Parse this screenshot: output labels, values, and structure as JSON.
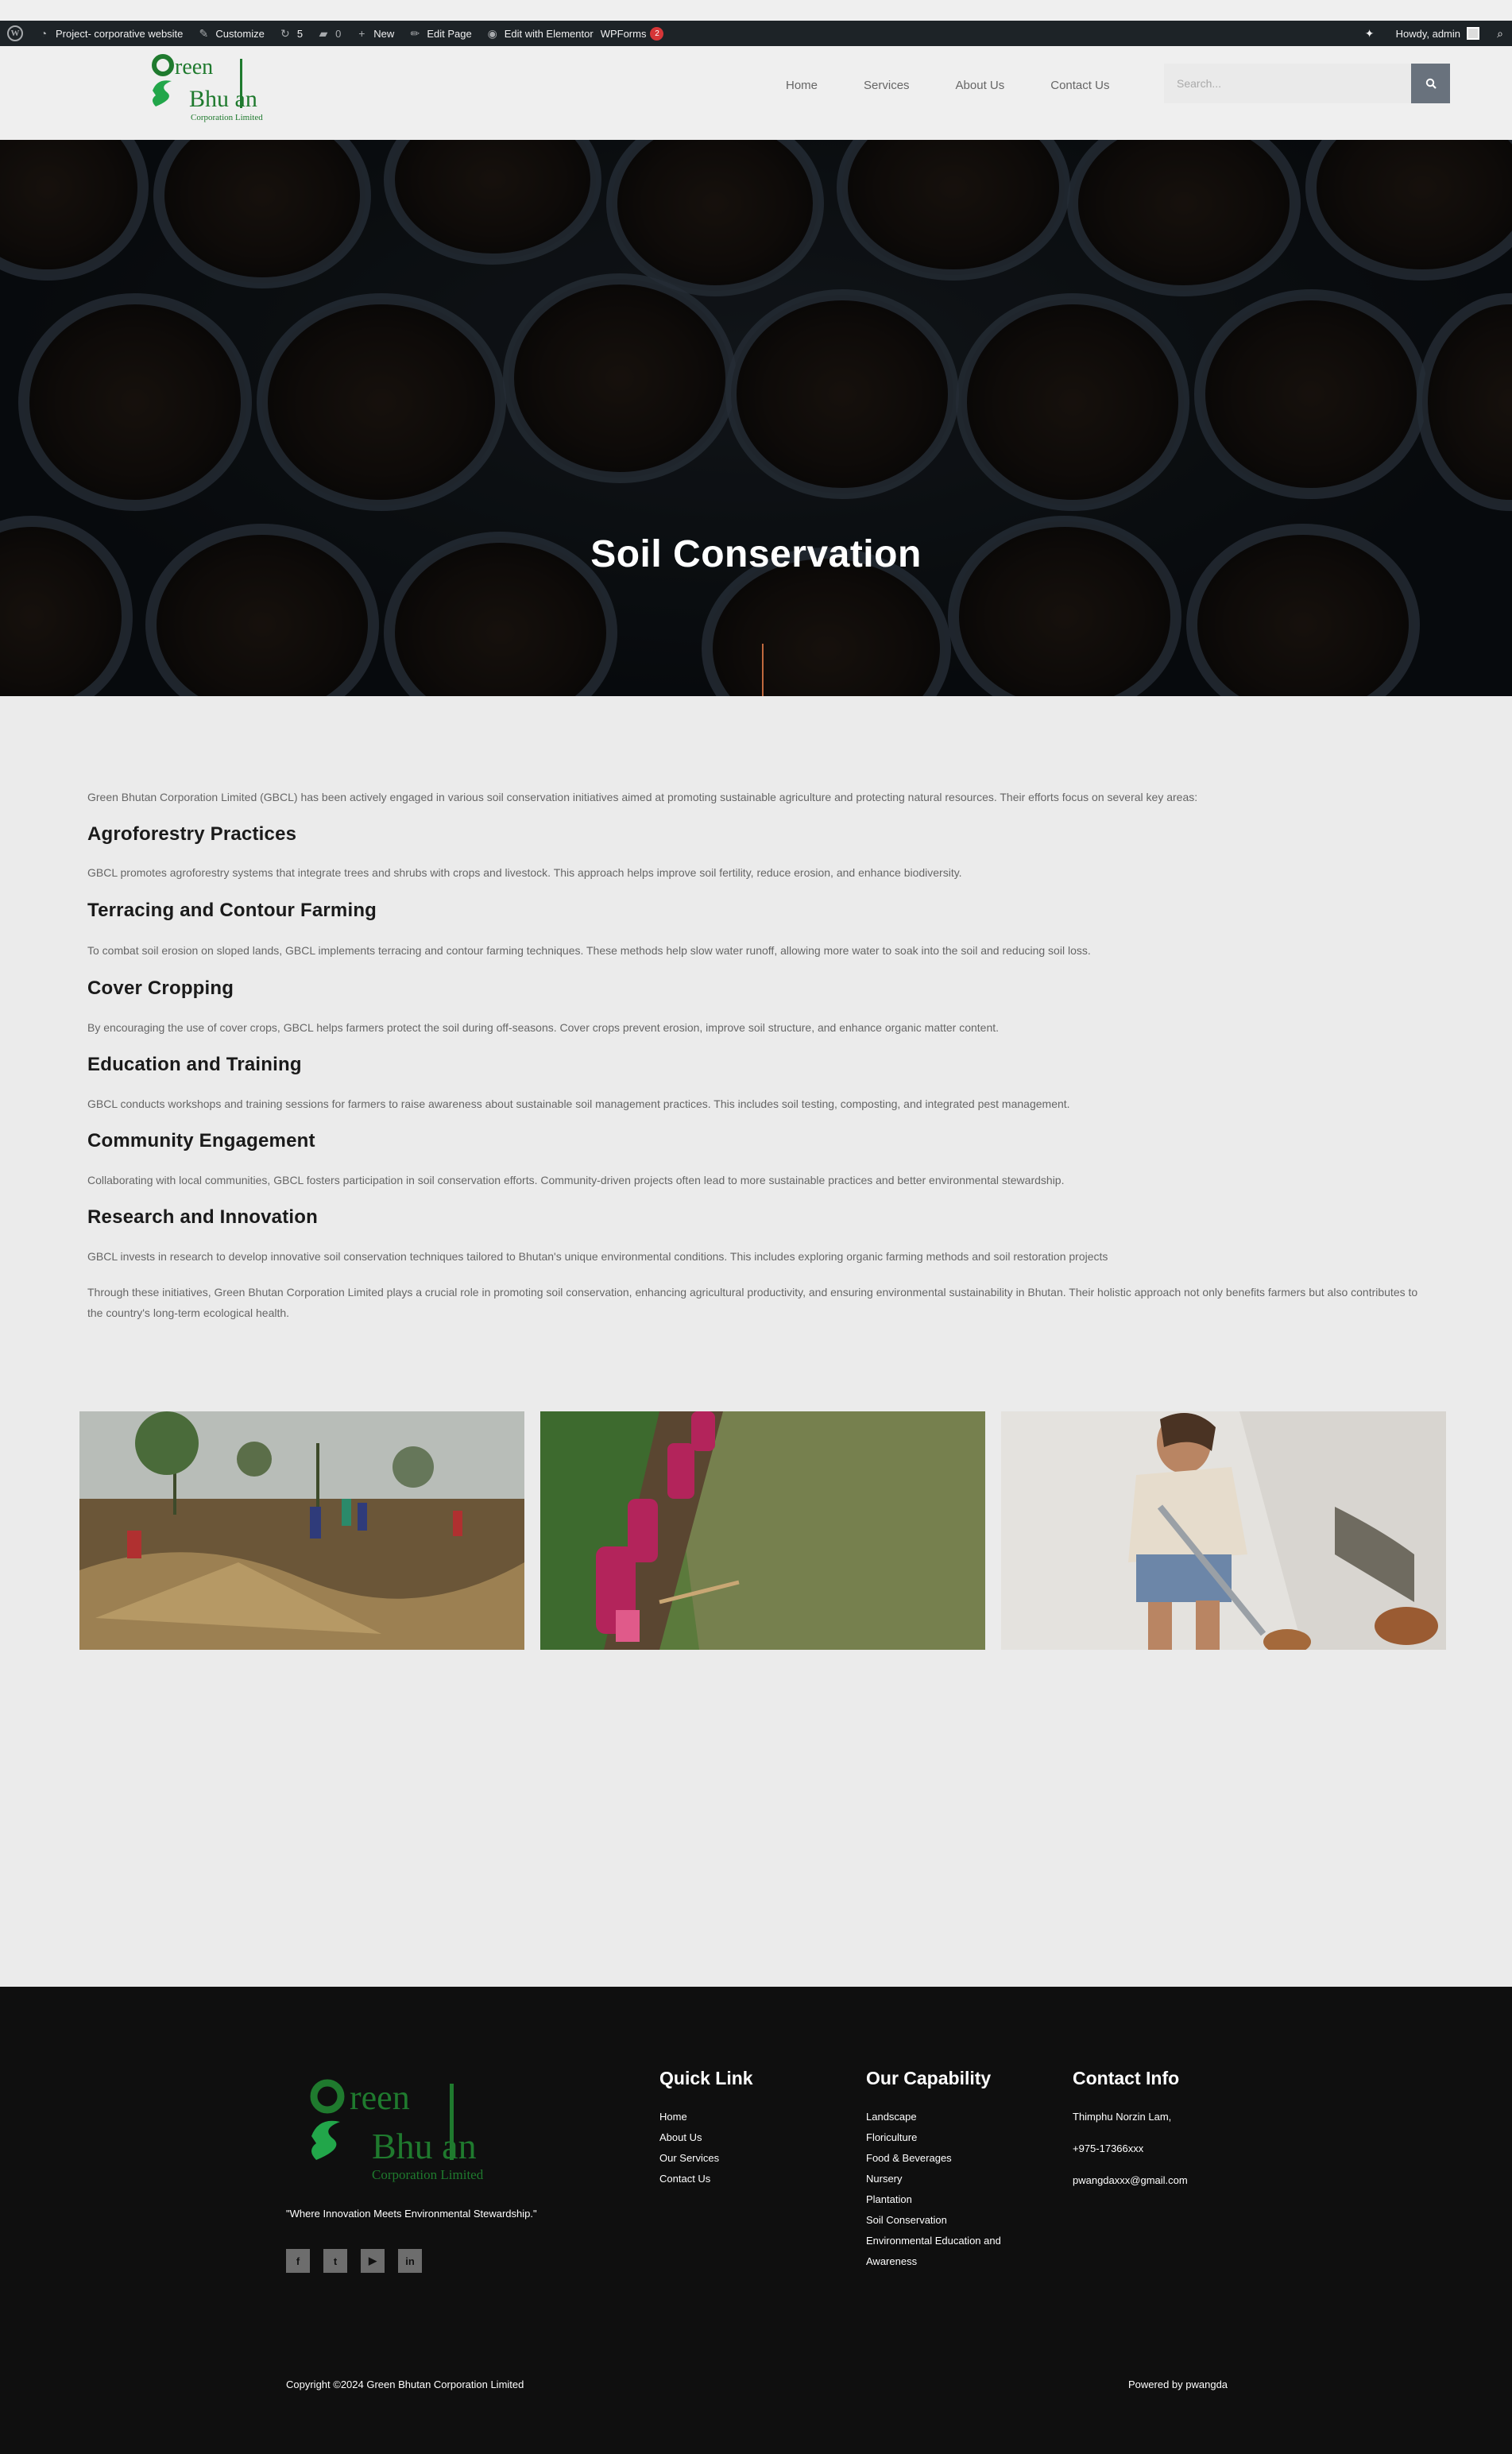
{
  "admin_bar": {
    "site_name": "Project- corporative website",
    "customize": "Customize",
    "updates_count": "5",
    "comments_count": "0",
    "new": "New",
    "edit_page": "Edit Page",
    "edit_elementor": "Edit with Elementor",
    "wpforms": "WPForms",
    "wpforms_badge": "2",
    "howdy": "Howdy, admin"
  },
  "header": {
    "logo_text_top": "reen",
    "logo_text_bottom": "Bhu an",
    "logo_subtitle": "Corporation Limited",
    "nav": [
      "Home",
      "Services",
      "About Us",
      "Contact Us"
    ],
    "search_placeholder": "Search..."
  },
  "hero": {
    "title": "Soil Conservation"
  },
  "content": {
    "intro": "Green Bhutan Corporation Limited (GBCL) has been actively engaged in various soil conservation initiatives aimed at promoting sustainable agriculture and protecting natural resources. Their efforts focus on several key areas:",
    "sections": [
      {
        "heading": "Agroforestry Practices",
        "text": "GBCL promotes agroforestry systems that integrate trees and shrubs with crops and livestock. This approach helps improve soil fertility, reduce erosion, and enhance biodiversity."
      },
      {
        "heading": "Terracing and Contour Farming",
        "text": "To combat soil erosion on sloped lands, GBCL implements terracing and contour farming techniques. These methods help slow water runoff, allowing more water to soak into the soil and reducing soil loss."
      },
      {
        "heading": "Cover Cropping",
        "text": "By encouraging the use of cover crops, GBCL helps farmers protect the soil during off-seasons. Cover crops prevent erosion, improve soil structure, and enhance organic matter content."
      },
      {
        "heading": "Education and Training",
        "text": "GBCL conducts workshops and training sessions for farmers to raise awareness about sustainable soil management practices. This includes soil testing, composting, and integrated pest management."
      },
      {
        "heading": "Community Engagement",
        "text": "Collaborating with local communities, GBCL fosters participation in soil conservation efforts. Community-driven projects often lead to more sustainable practices and better environmental stewardship."
      },
      {
        "heading": "Research and Innovation",
        "text": "GBCL invests in research to develop innovative soil conservation techniques tailored to Bhutan's unique environmental conditions. This includes exploring organic farming methods and soil restoration projects"
      }
    ],
    "conclusion": "Through these initiatives, Green Bhutan Corporation Limited plays a crucial role in promoting soil conservation, enhancing agricultural productivity, and ensuring environmental sustainability in Bhutan. Their holistic approach not only benefits farmers but also contributes to the country's long-term ecological health."
  },
  "colors": {
    "brand_green": "#1f7a2e",
    "brand_green_light": "#22a64a",
    "hero_accent": "#c0693e",
    "search_button": "#69727d",
    "admin_bar": "#1d2327",
    "footer_bg": "#0f0f0f"
  },
  "footer": {
    "quote": "\"Where Innovation Meets Environmental Stewardship.\"",
    "social_icons": [
      "facebook-icon",
      "twitter-icon",
      "youtube-icon",
      "linkedin-icon"
    ],
    "quick_link": {
      "title": "Quick Link",
      "items": [
        "Home",
        "About Us",
        "Our Services",
        "Contact Us"
      ]
    },
    "capability": {
      "title": "Our Capability",
      "items": [
        "Landscape",
        "Floriculture",
        "Food & Beverages",
        "Nursery",
        "Plantation",
        "Soil Conservation",
        "Environmental Education and",
        "Awareness"
      ]
    },
    "contact": {
      "title": "Contact Info",
      "items": [
        "Thimphu Norzin Lam,",
        "+975-17366xxx",
        "pwangdaxxx@gmail.com"
      ]
    },
    "copyright": "Copyright ©2024 Green Bhutan Corporation Limited",
    "powered": "Powered by pwangda"
  }
}
